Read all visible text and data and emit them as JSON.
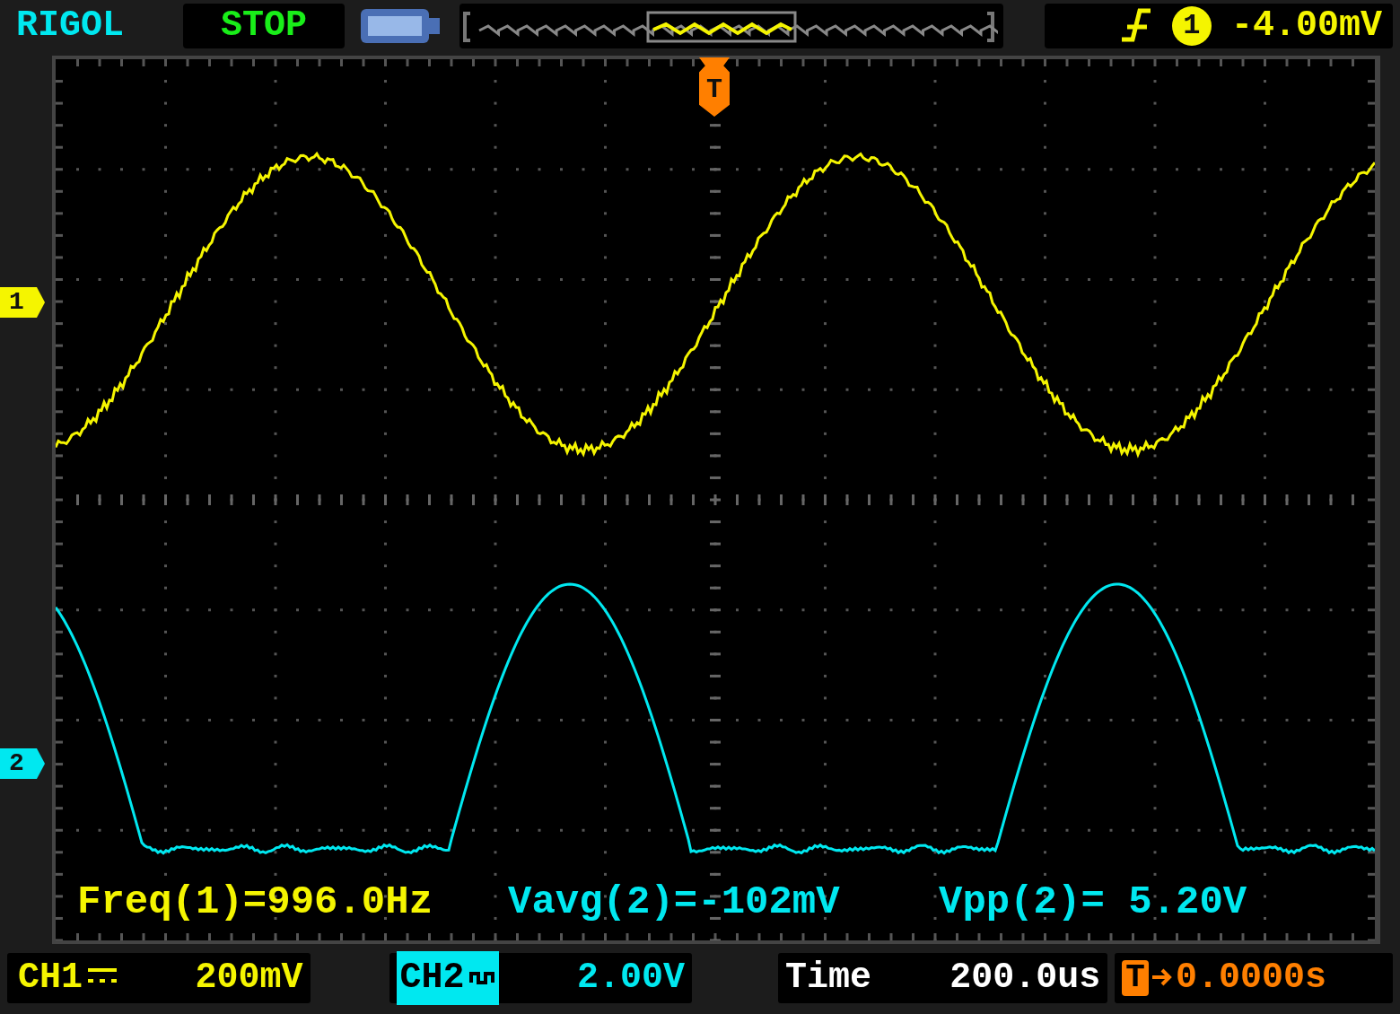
{
  "brand": "RIGOL",
  "run_state": "STOP",
  "trigger": {
    "source": "1",
    "level": "-4.00mV",
    "marker": "T"
  },
  "channel_markers": [
    {
      "label": "1",
      "color": "#f5f500"
    },
    {
      "label": "2",
      "color": "#00e8f0"
    }
  ],
  "measurements": [
    {
      "text": "Freq(1)=996.0Hz",
      "color": "#f5f500"
    },
    {
      "text": "Vavg(2)=-102mV",
      "color": "#00e8f0"
    },
    {
      "text": "Vpp(2)= 5.20V",
      "color": "#00e8f0"
    }
  ],
  "channels": [
    {
      "label": "CH1",
      "kind": "dc",
      "scale": "200mV",
      "selected": false,
      "color": "#f5f500"
    },
    {
      "label": "CH2",
      "kind": "ac",
      "scale": "2.00V",
      "selected": true,
      "color": "#00e8f0"
    }
  ],
  "timebase": {
    "label": "Time",
    "value": "200.0us"
  },
  "trigger_offset": {
    "marker": "T",
    "value": "0.0000s"
  }
}
